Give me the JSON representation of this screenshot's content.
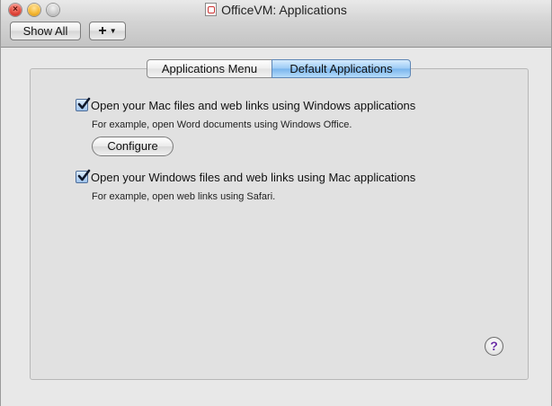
{
  "window": {
    "title": "OfficeVM: Applications"
  },
  "toolbar": {
    "show_all_label": "Show All",
    "add_label": "+"
  },
  "tabs": [
    {
      "label": "Applications Menu",
      "selected": false
    },
    {
      "label": "Default Applications",
      "selected": true
    }
  ],
  "options": [
    {
      "label": "Open your Mac files and web links using Windows applications",
      "description": "For example, open Word documents using Windows Office.",
      "checked": true
    },
    {
      "label": "Open your Windows files and web links using Mac applications",
      "description": "For example, open web links using Safari.",
      "checked": true
    }
  ],
  "configure_label": "Configure",
  "help_label": "?",
  "colors": {
    "tab_active": "#79b4ec",
    "close": "#e0453a",
    "minimize": "#f5b731",
    "zoom": "#c7c7c7"
  }
}
